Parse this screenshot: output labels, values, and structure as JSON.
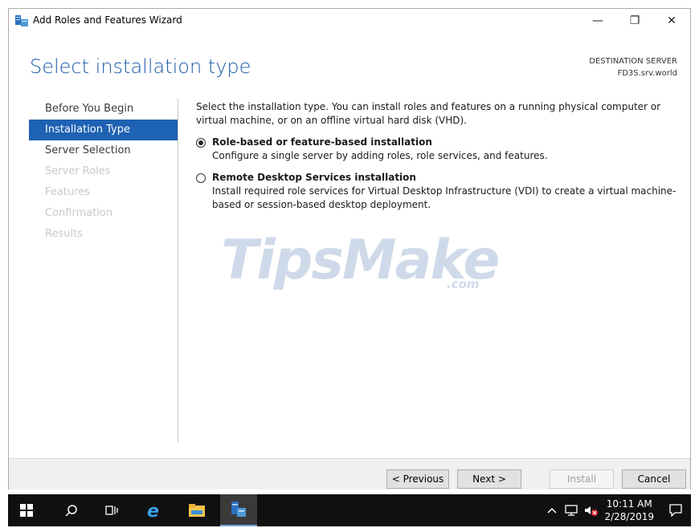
{
  "window": {
    "title": "Add Roles and Features Wizard",
    "minimize_glyph": "—",
    "restore_glyph": "❐",
    "close_glyph": "✕"
  },
  "page": {
    "heading": "Select installation type",
    "destination_label": "DESTINATION SERVER",
    "destination_server": "FD3S.srv.world"
  },
  "sidebar": {
    "items": [
      {
        "label": "Before You Begin",
        "state": "normal"
      },
      {
        "label": "Installation Type",
        "state": "active"
      },
      {
        "label": "Server Selection",
        "state": "normal"
      },
      {
        "label": "Server Roles",
        "state": "disabled"
      },
      {
        "label": "Features",
        "state": "disabled"
      },
      {
        "label": "Confirmation",
        "state": "disabled"
      },
      {
        "label": "Results",
        "state": "disabled"
      }
    ]
  },
  "content": {
    "intro": "Select the installation type. You can install roles and features on a running physical computer or virtual machine, or on an offline virtual hard disk (VHD).",
    "options": [
      {
        "label": "Role-based or feature-based installation",
        "description": "Configure a single server by adding roles, role services, and features.",
        "selected": true
      },
      {
        "label": "Remote Desktop Services installation",
        "description": "Install required role services for Virtual Desktop Infrastructure (VDI) to create a virtual machine-based or session-based desktop deployment.",
        "selected": false
      }
    ]
  },
  "watermark": {
    "text": "TipsMake",
    "suffix": ".com"
  },
  "footer": {
    "previous": "< Previous",
    "next": "Next >",
    "install": "Install",
    "cancel": "Cancel"
  },
  "taskbar": {
    "time": "10:11 AM",
    "date": "2/28/2019",
    "icons": [
      "windows-start-icon",
      "search-icon",
      "task-view-icon",
      "internet-explorer-icon",
      "file-explorer-icon",
      "server-manager-icon"
    ],
    "tray_icons": [
      "chevron-up-icon",
      "network-icon",
      "volume-muted-icon",
      "notification-icon"
    ]
  },
  "colors": {
    "accent": "#1e62b4",
    "heading": "#1e5aa8",
    "taskbar": "#101010"
  }
}
